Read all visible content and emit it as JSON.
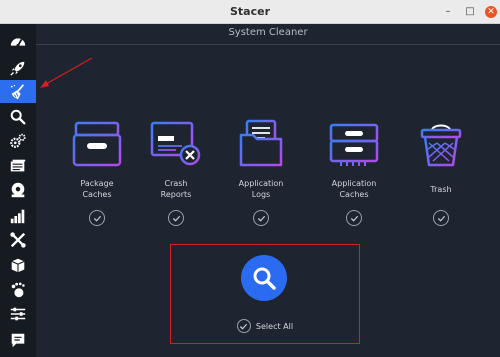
{
  "window": {
    "title": "Stacer",
    "minimize_glyph": "–",
    "maximize_glyph": "□",
    "close_glyph": "✕"
  },
  "sidebar": {
    "items": [
      {
        "name": "dashboard",
        "icon": "speedometer-icon",
        "active": false
      },
      {
        "name": "startup-apps",
        "icon": "rocket-icon",
        "active": false
      },
      {
        "name": "system-cleaner",
        "icon": "broom-icon",
        "active": true
      },
      {
        "name": "search",
        "icon": "search-icon",
        "active": false
      },
      {
        "name": "services",
        "icon": "gears-icon",
        "active": false
      },
      {
        "name": "processes",
        "icon": "processes-icon",
        "active": false
      },
      {
        "name": "uninstaller",
        "icon": "disk-icon",
        "active": false
      },
      {
        "name": "resources",
        "icon": "bar-chart-icon",
        "active": false
      },
      {
        "name": "helpers",
        "icon": "wrench-icon",
        "active": false
      },
      {
        "name": "apt-repository",
        "icon": "package-box-icon",
        "active": false
      },
      {
        "name": "gnome-settings",
        "icon": "gnome-foot-icon",
        "active": false
      },
      {
        "name": "settings",
        "icon": "sliders-icon",
        "active": false
      },
      {
        "name": "feedback",
        "icon": "speech-bubble-icon",
        "active": false
      }
    ]
  },
  "main": {
    "header_title": "System Cleaner",
    "categories": [
      {
        "label": "Package\nCaches",
        "icon": "package-cache-icon",
        "checked": true
      },
      {
        "label": "Crash\nReports",
        "icon": "crash-report-icon",
        "checked": true
      },
      {
        "label": "Application\nLogs",
        "icon": "app-logs-icon",
        "checked": true
      },
      {
        "label": "Application\nCaches",
        "icon": "app-caches-icon",
        "checked": true
      },
      {
        "label": "Trash",
        "icon": "trash-basket-icon",
        "checked": true
      }
    ],
    "select_all_label": "Select All",
    "scan_button_icon": "search-icon"
  },
  "colors": {
    "accent": "#2a6bf2",
    "icon_gradient_start": "#3a7df5",
    "icon_gradient_end": "#b34ae8",
    "highlight_box": "#d61f1f"
  }
}
